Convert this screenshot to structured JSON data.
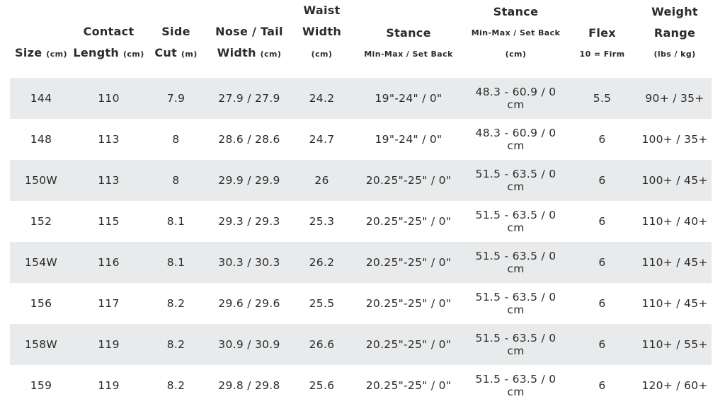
{
  "header": {
    "size": {
      "label": "Size",
      "unit": "(cm)"
    },
    "contact_length": {
      "line1": "Contact",
      "line2": "Length",
      "unit": "(cm)"
    },
    "side_cut": {
      "line1": "Side",
      "line2": "Cut",
      "unit": "(m)"
    },
    "nose_tail": {
      "line1": "Nose / Tail",
      "line2": "Width",
      "unit": "(cm)"
    },
    "waist": {
      "line1": "Waist",
      "line2": "Width",
      "unit": "(cm)"
    },
    "stance_in": {
      "line1": "Stance",
      "line2": "Min-Max / Set Back"
    },
    "stance_cm": {
      "line1": "Stance",
      "line2": "Min-Max / Set Back",
      "line3": "(cm)"
    },
    "flex": {
      "line1": "Flex",
      "line2": "10 = Firm"
    },
    "weight": {
      "line1": "Weight",
      "line2": "Range",
      "line3": "(lbs / kg)"
    }
  },
  "rows": [
    {
      "size": "144",
      "contact": "110",
      "sidecut": "7.9",
      "nose_tail": "27.9 / 27.9",
      "waist": "24.2",
      "stance_in": "19\"-24\" / 0\"",
      "stance_cm": "48.3 - 60.9 / 0 cm",
      "flex": "5.5",
      "weight": "90+ / 35+"
    },
    {
      "size": "148",
      "contact": "113",
      "sidecut": "8",
      "nose_tail": "28.6 / 28.6",
      "waist": "24.7",
      "stance_in": "19\"-24\" / 0\"",
      "stance_cm": "48.3 - 60.9 / 0 cm",
      "flex": "6",
      "weight": "100+ / 35+"
    },
    {
      "size": "150W",
      "contact": "113",
      "sidecut": "8",
      "nose_tail": "29.9 / 29.9",
      "waist": "26",
      "stance_in": "20.25\"-25\" / 0\"",
      "stance_cm": "51.5 - 63.5 / 0 cm",
      "flex": "6",
      "weight": "100+ / 45+"
    },
    {
      "size": "152",
      "contact": "115",
      "sidecut": "8.1",
      "nose_tail": "29.3 / 29.3",
      "waist": "25.3",
      "stance_in": "20.25\"-25\" / 0\"",
      "stance_cm": "51.5 - 63.5 / 0 cm",
      "flex": "6",
      "weight": "110+ / 40+"
    },
    {
      "size": "154W",
      "contact": "116",
      "sidecut": "8.1",
      "nose_tail": "30.3 / 30.3",
      "waist": "26.2",
      "stance_in": "20.25\"-25\" / 0\"",
      "stance_cm": "51.5 - 63.5 / 0 cm",
      "flex": "6",
      "weight": "110+ / 45+"
    },
    {
      "size": "156",
      "contact": "117",
      "sidecut": "8.2",
      "nose_tail": "29.6 / 29.6",
      "waist": "25.5",
      "stance_in": "20.25\"-25\" / 0\"",
      "stance_cm": "51.5 - 63.5 / 0 cm",
      "flex": "6",
      "weight": "110+ / 45+"
    },
    {
      "size": "158W",
      "contact": "119",
      "sidecut": "8.2",
      "nose_tail": "30.9 / 30.9",
      "waist": "26.6",
      "stance_in": "20.25\"-25\" / 0\"",
      "stance_cm": "51.5 - 63.5 / 0 cm",
      "flex": "6",
      "weight": "110+ / 55+"
    },
    {
      "size": "159",
      "contact": "119",
      "sidecut": "8.2",
      "nose_tail": "29.8 / 29.8",
      "waist": "25.6",
      "stance_in": "20.25\"-25\" / 0\"",
      "stance_cm": "51.5 - 63.5 / 0 cm",
      "flex": "6",
      "weight": "120+ / 60+"
    }
  ],
  "colors": {
    "stripe": "#e9eaeb",
    "text": "#2b2b2b",
    "background": "#ffffff"
  }
}
